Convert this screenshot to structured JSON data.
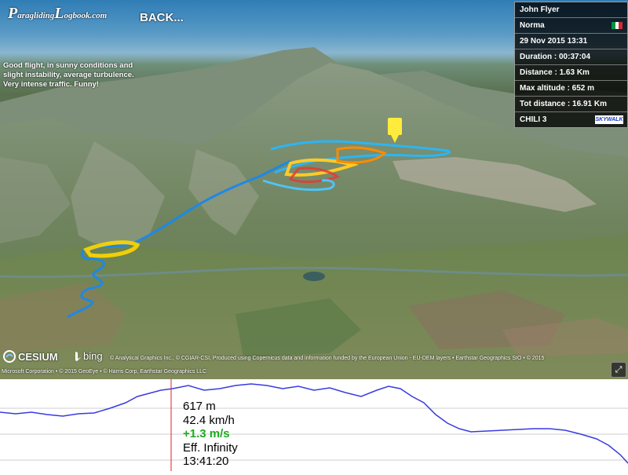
{
  "header": {
    "logo_text_first": "P",
    "logo_text_mid": "aragliding",
    "logo_text_L": "L",
    "logo_text_end": "ogbook.com",
    "back_label": "BACK..."
  },
  "description": "Good flight, in sunny conditions and slight instability, average turbulence. Very intense traffic. Funny!",
  "info_panel": {
    "pilot": "John Flyer",
    "site": "Norma",
    "country_flag_colors": [
      "#009246",
      "#ffffff",
      "#ce2b37"
    ],
    "date": "29 Nov 2015 13:31",
    "duration": "Duration : 00:37:04",
    "distance": "Distance : 1.63 Km",
    "max_altitude": "Max altitude : 652 m",
    "tot_distance": "Tot distance : 16.91 Km",
    "glider": "CHILI 3",
    "glider_brand": "SKYWALK"
  },
  "attribution": {
    "cesium": "CESIUM",
    "bing": "bing",
    "line1": "© Analytical Graphics Inc., © CGIAR-CSI, Produced using Copernicus data and information funded by the European Union - EU-DEM layers • Earthstar Geographics SIO • © 2015",
    "line2": "Microsoft Corporation • © 2015 GeoEye • © Harris Corp, Earthstar Geographics LLC"
  },
  "profile": {
    "altitude": "617 m",
    "speed": "42.4 km/h",
    "vario": "+1.3 m/s",
    "efficiency": "Eff. Infinity",
    "time": "13:41:20",
    "line_color": "#3a3ae0",
    "cursor_color": "#e02020",
    "climb_color": "#1eaa1e"
  }
}
